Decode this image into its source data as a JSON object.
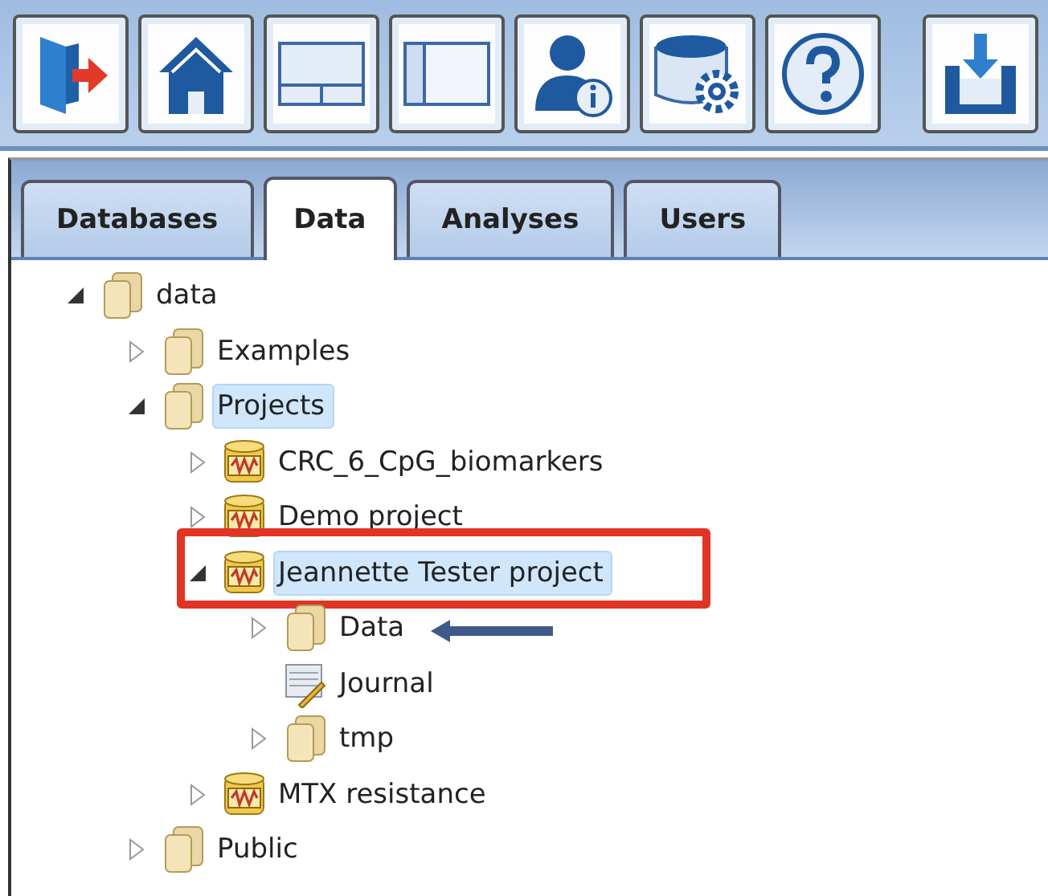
{
  "tabs": [
    {
      "label": "Databases",
      "selected": false
    },
    {
      "label": "Data",
      "selected": true
    },
    {
      "label": "Analyses",
      "selected": false
    },
    {
      "label": "Users",
      "selected": false
    }
  ],
  "tree": [
    {
      "label": "data",
      "kind": "folder",
      "expanded": true,
      "selected": false,
      "children": [
        {
          "label": "Examples",
          "kind": "folder",
          "expanded": false,
          "selected": false
        },
        {
          "label": "Projects",
          "kind": "folder",
          "expanded": true,
          "selected": true,
          "children": [
            {
              "label": "CRC_6_CpG_biomarkers",
              "kind": "project",
              "expanded": false,
              "selected": false
            },
            {
              "label": "Demo project",
              "kind": "project",
              "expanded": false,
              "selected": false
            },
            {
              "label": "Jeannette Tester project",
              "kind": "project",
              "expanded": true,
              "selected": true,
              "boxed": true,
              "children": [
                {
                  "label": "Data",
                  "kind": "folder",
                  "expanded": false,
                  "selected": false,
                  "arrowed": true
                },
                {
                  "label": "Journal",
                  "kind": "journal",
                  "selected": false
                },
                {
                  "label": "tmp",
                  "kind": "folder",
                  "expanded": false,
                  "selected": false
                }
              ]
            },
            {
              "label": "MTX resistance",
              "kind": "project",
              "expanded": false,
              "selected": false
            }
          ]
        },
        {
          "label": "Public",
          "kind": "folder",
          "expanded": false,
          "selected": false
        }
      ]
    }
  ]
}
